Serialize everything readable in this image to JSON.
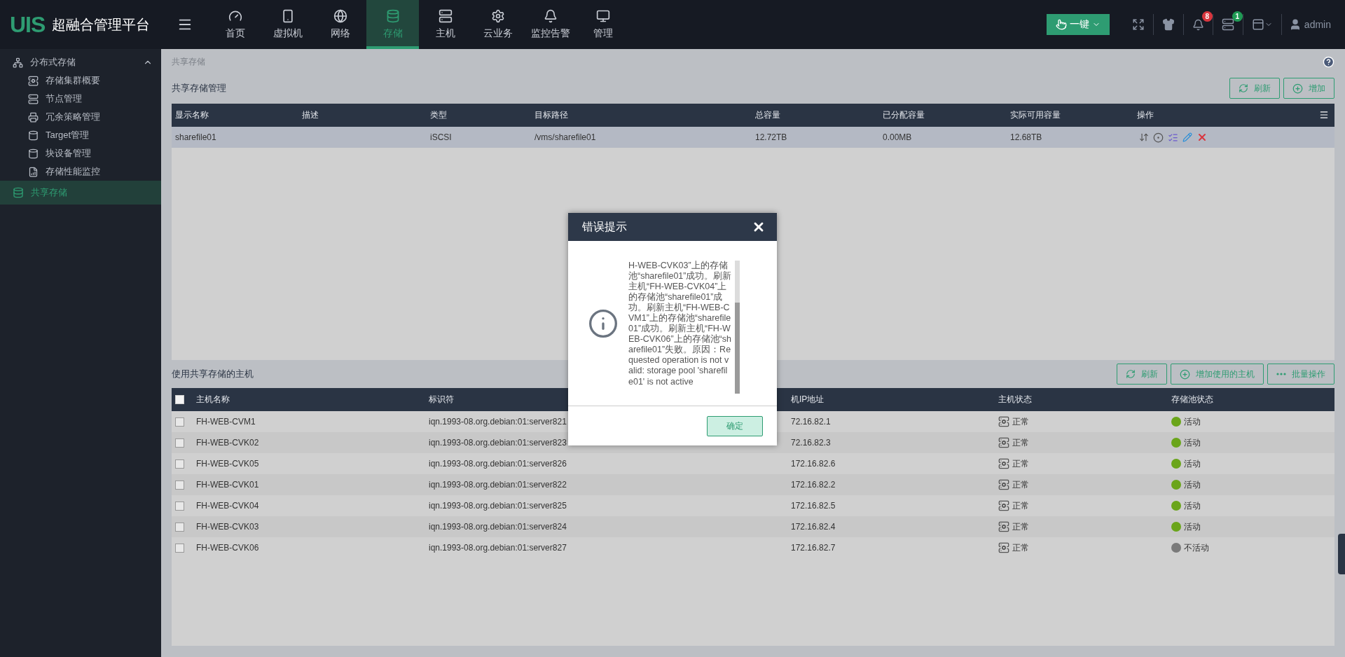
{
  "app": {
    "logo": "UIS",
    "title": "超融合管理平台"
  },
  "nav": [
    {
      "label": "首页",
      "selected": false
    },
    {
      "label": "虚拟机",
      "selected": false
    },
    {
      "label": "网络",
      "selected": false
    },
    {
      "label": "存储",
      "selected": true
    },
    {
      "label": "主机",
      "selected": false
    },
    {
      "label": "云业务",
      "selected": false
    },
    {
      "label": "监控告警",
      "selected": false
    },
    {
      "label": "管理",
      "selected": false
    }
  ],
  "toolbar": {
    "one_click": "一键",
    "alerts_badge": "8",
    "tasks_badge": "1",
    "user": "admin"
  },
  "sidebar": {
    "groups": [
      {
        "label": "分布式存储",
        "expanded": true,
        "selected": false,
        "children": [
          {
            "label": "存储集群概要",
            "selected": false
          },
          {
            "label": "节点管理",
            "selected": false
          },
          {
            "label": "冗余策略管理",
            "selected": false
          },
          {
            "label": "Target管理",
            "selected": false
          },
          {
            "label": "块设备管理",
            "selected": false
          },
          {
            "label": "存储性能监控",
            "selected": false
          }
        ]
      },
      {
        "label": "共享存储",
        "expanded": false,
        "selected": true
      }
    ]
  },
  "breadcrumb": "共享存储",
  "storage": {
    "title": "共享存储管理",
    "buttons": [
      {
        "label": "刷新",
        "kind": "refresh"
      },
      {
        "label": "增加",
        "kind": "add"
      }
    ],
    "columns": [
      "显示名称",
      "描述",
      "类型",
      "目标路径",
      "总容量",
      "已分配容量",
      "实际可用容量",
      "操作"
    ],
    "rows": [
      {
        "selected": true,
        "cells": [
          "sharefile01",
          "",
          "iSCSI",
          "/vms/sharefile01",
          "12.72TB",
          "0.00MB",
          "12.68TB"
        ]
      }
    ]
  },
  "hosts": {
    "title": "使用共享存储的主机",
    "buttons": [
      {
        "label": "刷新",
        "kind": "refresh"
      },
      {
        "label": "增加使用的主机",
        "kind": "add"
      },
      {
        "label": "批量操作",
        "kind": "more"
      }
    ],
    "all_checked": false,
    "columns": [
      "主机名称",
      "标识符",
      "机IP地址",
      "主机状态",
      "存储池状态"
    ],
    "rows": [
      {
        "checked": false,
        "name": "FH-WEB-CVM1",
        "iqn": "iqn.1993-08.org.debian:01:server821",
        "ip": "72.16.82.1",
        "host_status": "正常",
        "pool_status": "活动",
        "active": true
      },
      {
        "checked": false,
        "name": "FH-WEB-CVK02",
        "iqn": "iqn.1993-08.org.debian:01:server823",
        "ip": "72.16.82.3",
        "host_status": "正常",
        "pool_status": "活动",
        "active": true
      },
      {
        "checked": false,
        "name": "FH-WEB-CVK05",
        "iqn": "iqn.1993-08.org.debian:01:server826",
        "ip": "172.16.82.6",
        "host_status": "正常",
        "pool_status": "活动",
        "active": true
      },
      {
        "checked": false,
        "name": "FH-WEB-CVK01",
        "iqn": "iqn.1993-08.org.debian:01:server822",
        "ip": "172.16.82.2",
        "host_status": "正常",
        "pool_status": "活动",
        "active": true
      },
      {
        "checked": false,
        "name": "FH-WEB-CVK04",
        "iqn": "iqn.1993-08.org.debian:01:server825",
        "ip": "172.16.82.5",
        "host_status": "正常",
        "pool_status": "活动",
        "active": true
      },
      {
        "checked": false,
        "name": "FH-WEB-CVK03",
        "iqn": "iqn.1993-08.org.debian:01:server824",
        "ip": "172.16.82.4",
        "host_status": "正常",
        "pool_status": "活动",
        "active": true
      },
      {
        "checked": false,
        "name": "FH-WEB-CVK06",
        "iqn": "iqn.1993-08.org.debian:01:server827",
        "ip": "172.16.82.7",
        "host_status": "正常",
        "pool_status": "不活动",
        "active": false
      }
    ]
  },
  "dialog": {
    "title": "错误提示",
    "message": "H-WEB-CVK03”上的存储池“sharefile01”成功。刷新主机“FH-WEB-CVK04”上的存储池“sharefile01”成功。刷新主机“FH-WEB-CVM1”上的存储池“sharefile01”成功。刷新主机“FH-WEB-CVK06”上的存储池“sharefile01”失败。原因：Requested operation is not valid: storage pool 'sharefile01' is not active",
    "confirm": "确定"
  }
}
